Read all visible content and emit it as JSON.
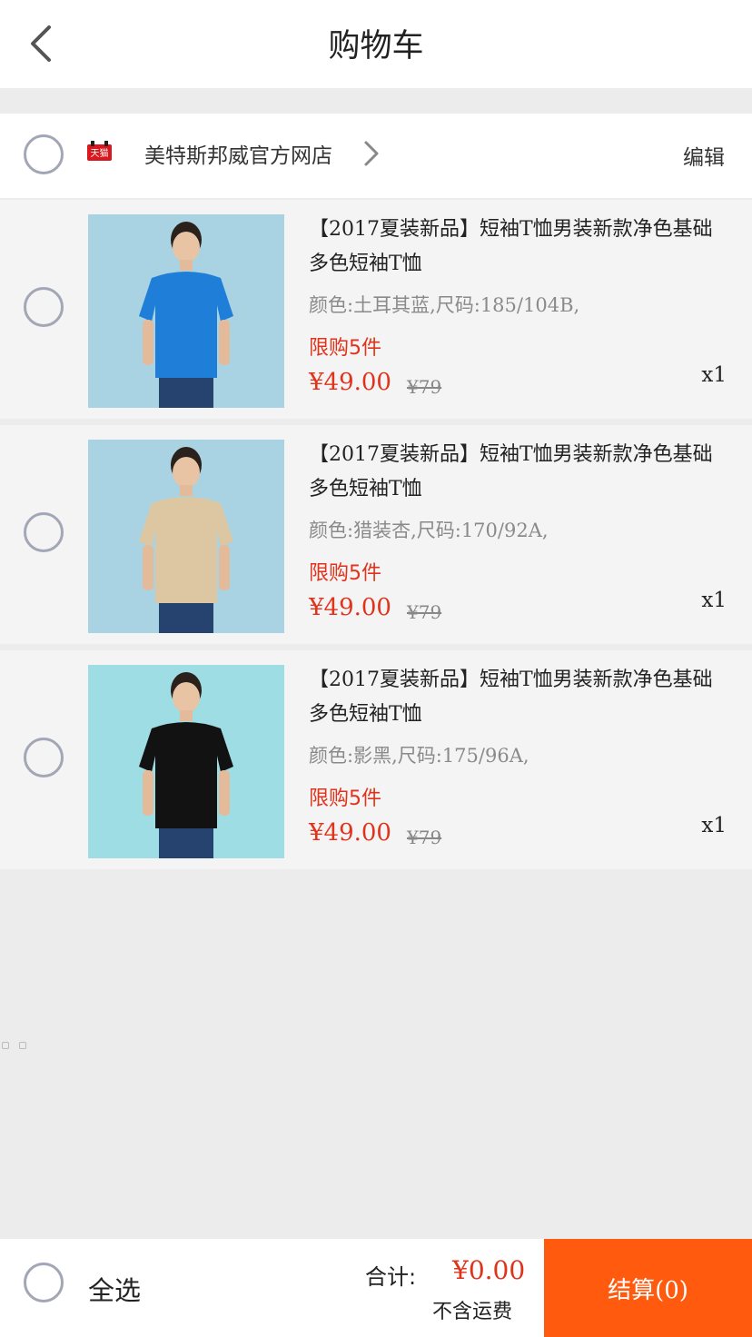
{
  "header": {
    "title": "购物车"
  },
  "shop": {
    "name": "美特斯邦威官方网店",
    "edit_label": "编辑",
    "badge_text": "天猫"
  },
  "items": [
    {
      "title": "【2017夏装新品】短袖T恤男装新款净色基础多色短袖T恤",
      "spec": "颜色:土耳其蓝,尺码:185/104B,",
      "limit": "限购5件",
      "price": "¥49.00",
      "original_price": "¥79",
      "qty": "x1",
      "shirt_color": "#1f7fd8",
      "bg_color": "#a9d3e3"
    },
    {
      "title": "【2017夏装新品】短袖T恤男装新款净色基础多色短袖T恤",
      "spec": "颜色:猎装杏,尺码:170/92A,",
      "limit": "限购5件",
      "price": "¥49.00",
      "original_price": "¥79",
      "qty": "x1",
      "shirt_color": "#dcc7a2",
      "bg_color": "#a9d3e3"
    },
    {
      "title": "【2017夏装新品】短袖T恤男装新款净色基础多色短袖T恤",
      "spec": "颜色:影黑,尺码:175/96A,",
      "limit": "限购5件",
      "price": "¥49.00",
      "original_price": "¥79",
      "qty": "x1",
      "shirt_color": "#121212",
      "bg_color": "#9fdde4"
    }
  ],
  "footer": {
    "select_all": "全选",
    "total_label": "合计:",
    "total_amount": "¥0.00",
    "shipping_note": "不含运费",
    "checkout_label": "结算(0)"
  },
  "colors": {
    "accent": "#ff5a0e",
    "price": "#e0331c"
  }
}
